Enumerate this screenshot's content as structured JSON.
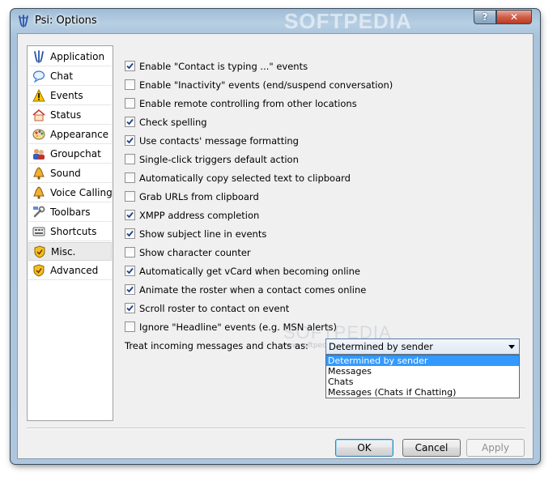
{
  "window": {
    "title": "Psi: Options",
    "watermark": "SOFTPEDIA",
    "help_button": "?",
    "close_button": "✕"
  },
  "sidebar": {
    "items": [
      {
        "label": "Application",
        "icon": "psi-app-icon"
      },
      {
        "label": "Chat",
        "icon": "chat-bubble-icon"
      },
      {
        "label": "Events",
        "icon": "warning-icon"
      },
      {
        "label": "Status",
        "icon": "status-house-icon"
      },
      {
        "label": "Appearance",
        "icon": "palette-icon"
      },
      {
        "label": "Groupchat",
        "icon": "group-people-icon"
      },
      {
        "label": "Sound",
        "icon": "bell-icon"
      },
      {
        "label": "Voice Calling",
        "icon": "bell-icon"
      },
      {
        "label": "Toolbars",
        "icon": "toolbar-wrench-icon"
      },
      {
        "label": "Shortcuts",
        "icon": "shortcuts-icon"
      },
      {
        "label": "Misc.",
        "icon": "shield-icon"
      },
      {
        "label": "Advanced",
        "icon": "shield-icon"
      }
    ],
    "selected_index": 10
  },
  "options": [
    {
      "label": "Enable \"Contact is typing ...\" events",
      "checked": true
    },
    {
      "label": "Enable \"Inactivity\" events (end/suspend conversation)",
      "checked": false
    },
    {
      "label": "Enable remote controlling from other locations",
      "checked": false
    },
    {
      "label": "Check spelling",
      "checked": true
    },
    {
      "label": "Use contacts' message formatting",
      "checked": true
    },
    {
      "label": "Single-click triggers default action",
      "checked": false
    },
    {
      "label": "Automatically copy selected text to clipboard",
      "checked": false
    },
    {
      "label": "Grab URLs from clipboard",
      "checked": false
    },
    {
      "label": "XMPP address completion",
      "checked": true
    },
    {
      "label": "Show subject line in events",
      "checked": true
    },
    {
      "label": "Show character counter",
      "checked": false
    },
    {
      "label": "Automatically get vCard when becoming online",
      "checked": true
    },
    {
      "label": "Animate the roster when a contact comes online",
      "checked": true
    },
    {
      "label": "Scroll roster to contact on event",
      "checked": true
    },
    {
      "label": "Ignore \"Headline\" events (e.g. MSN alerts)",
      "checked": false
    }
  ],
  "treat_incoming": {
    "label": "Treat incoming messages and chats as:",
    "selected": "Determined by sender",
    "options": [
      "Determined by sender",
      "Messages",
      "Chats",
      "Messages (Chats if Chatting)"
    ],
    "highlighted_index": 0
  },
  "overlay_watermark": {
    "large": "SOFTPEDIA",
    "small": "www.softpedia.com"
  },
  "buttons": {
    "ok": "OK",
    "cancel": "Cancel",
    "apply": "Apply"
  }
}
